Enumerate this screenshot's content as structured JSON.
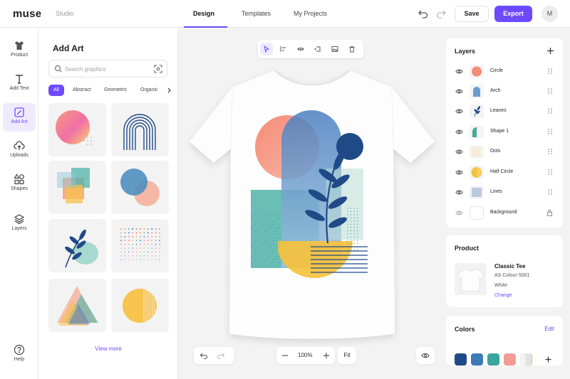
{
  "app": {
    "logo": "muse",
    "workspace": "Studio"
  },
  "nav": {
    "tabs": [
      "Design",
      "Templates",
      "My Projects"
    ],
    "active": "Design"
  },
  "header": {
    "save_label": "Save",
    "export_label": "Export",
    "avatar_initial": "M"
  },
  "rail": {
    "items": [
      {
        "label": "Product",
        "icon": "tshirt-icon"
      },
      {
        "label": "Add Text",
        "icon": "text-icon"
      },
      {
        "label": "Add Art",
        "icon": "art-icon",
        "active": true
      },
      {
        "label": "Uploads",
        "icon": "cloud-upload-icon"
      },
      {
        "label": "Shapes",
        "icon": "shapes-icon"
      },
      {
        "label": "Layers",
        "icon": "layers-icon"
      }
    ],
    "help_label": "Help"
  },
  "art_panel": {
    "title": "Add Art",
    "search_placeholder": "Search graphics",
    "chips": [
      "All",
      "Abstract",
      "Geometric",
      "Organic"
    ],
    "active_chip": "All",
    "view_more": "View more"
  },
  "canvas": {
    "zoom": "100%",
    "fit_label": "Fit"
  },
  "layers": {
    "title": "Layers",
    "items": [
      {
        "name": "Circle",
        "visible": true
      },
      {
        "name": "Arch",
        "visible": true
      },
      {
        "name": "Leaves",
        "visible": true
      },
      {
        "name": "Shape 1",
        "visible": true
      },
      {
        "name": "Dots",
        "visible": true
      },
      {
        "name": "Half Circle",
        "visible": true
      },
      {
        "name": "Lines",
        "visible": true
      },
      {
        "name": "Background",
        "visible": false,
        "locked": true
      }
    ]
  },
  "product": {
    "title": "Product",
    "name": "Classic Tee",
    "model": "AS Colour 5001",
    "color": "White",
    "change_label": "Change"
  },
  "colors": {
    "title": "Colors",
    "edit_label": "Edit",
    "swatches": [
      "#1f4a86",
      "#3d7ab8",
      "#3aa59c",
      "#f29b95",
      "#f6c14b"
    ]
  },
  "palette": {
    "accent": "#6d4aff",
    "navy": "#1f4a86",
    "blue": "#5b8fc4",
    "teal": "#47a89c",
    "coral": "#f28b82",
    "yellow": "#f5c23e"
  }
}
